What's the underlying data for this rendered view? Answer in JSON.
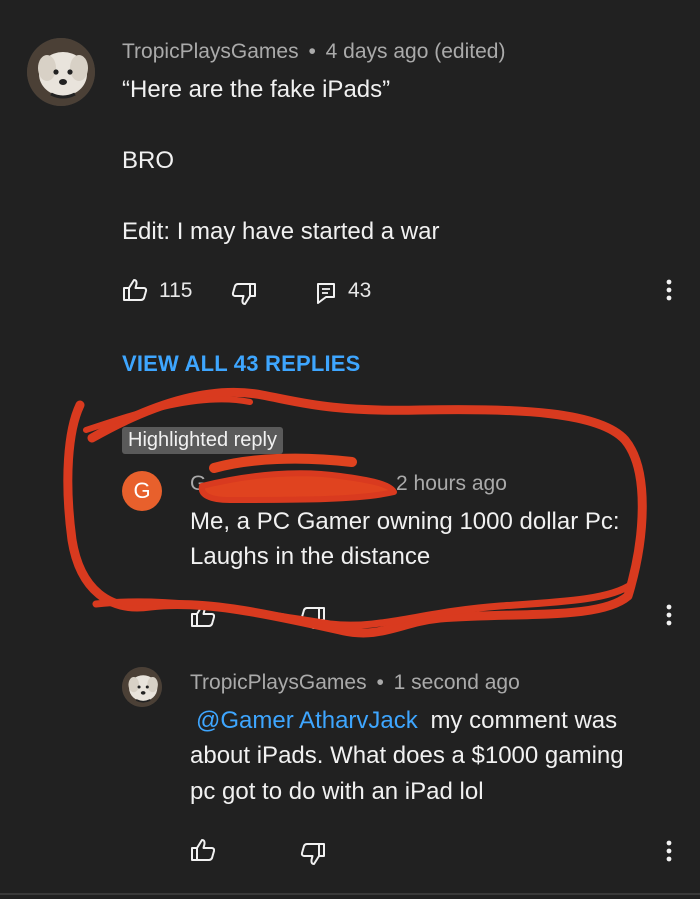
{
  "comment": {
    "author": "TropicPlaysGames",
    "separator": "•",
    "time": "4 days ago (edited)",
    "lines": [
      "“Here are the fake iPads”",
      "BRO",
      "Edit: I may have started a war"
    ],
    "likes": "115",
    "replies_count": "43",
    "view_replies_label": "VIEW ALL 43 REPLIES"
  },
  "highlighted": {
    "badge": "Highlighted reply",
    "avatar_letter": "G",
    "author_partial": "G",
    "time": "2 hours ago",
    "lines": [
      "Me, a PC Gamer owning 1000 dollar Pc:",
      "Laughs in the distance"
    ]
  },
  "reply": {
    "author": "TropicPlaysGames",
    "separator": "•",
    "time": "1 second ago",
    "mention": "@Gamer AtharvJack",
    "line1_rest": "my comment was",
    "line2": "about iPads. What does a $1000 gaming",
    "line3": "pc got to do with an iPad lol"
  },
  "icons": {
    "like": "thumbs-up-icon",
    "dislike": "thumbs-down-icon",
    "reply": "comment-icon",
    "more": "more-vert-icon"
  },
  "colors": {
    "background": "#212121",
    "link": "#3ea6ff",
    "avatar_letter_bg": "#e8602c",
    "scribble": "#d93a1f"
  }
}
